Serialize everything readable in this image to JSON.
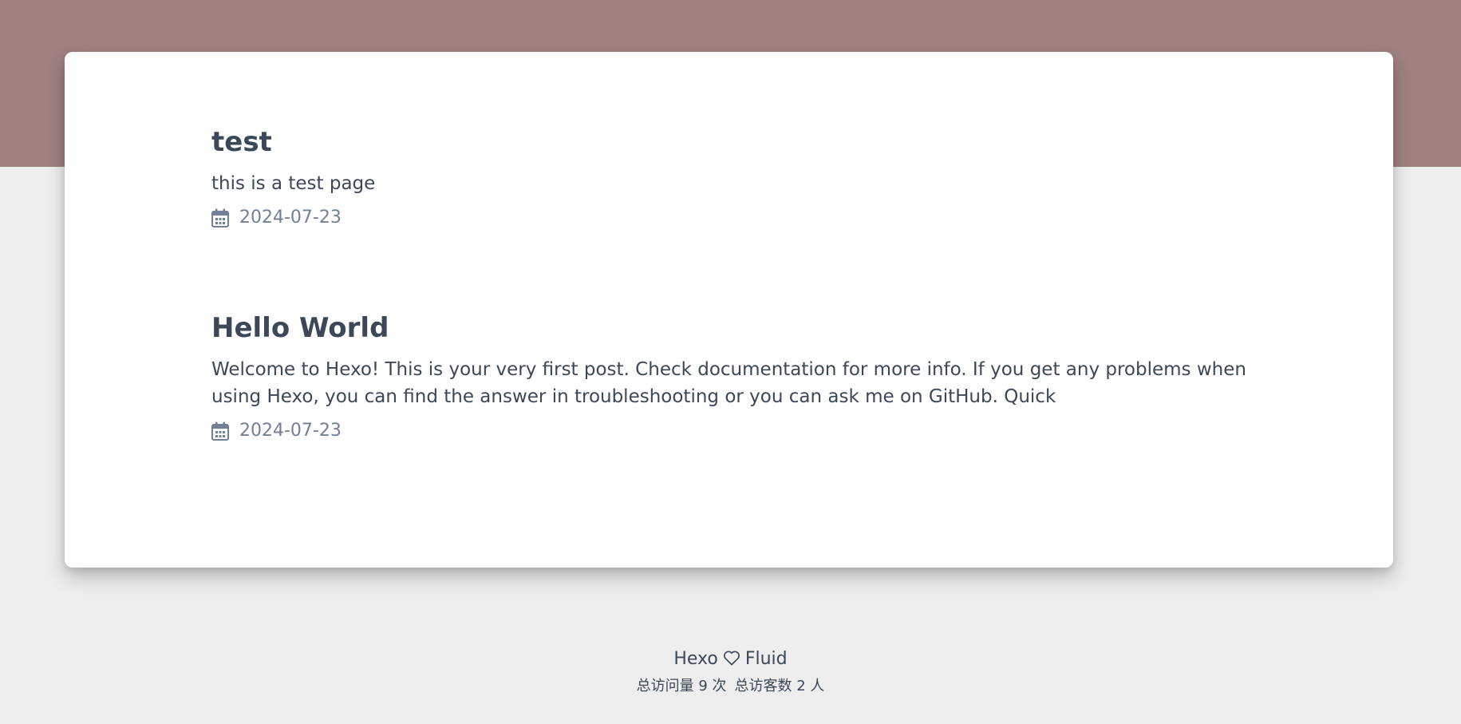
{
  "posts": [
    {
      "title": "test",
      "excerpt": "this is a test page",
      "date": "2024-07-23",
      "date_icon": "calendar-icon"
    },
    {
      "title": "Hello World",
      "excerpt": "Welcome to Hexo! This is your very first post. Check documentation for more info. If you get any problems when using Hexo, you can find the answer in troubleshooting or you can ask me on GitHub. Quick",
      "date": "2024-07-23",
      "date_icon": "calendar-icon"
    }
  ],
  "footer": {
    "hexo_label": "Hexo",
    "heart_icon": "heart-icon",
    "fluid_label": "Fluid",
    "stats": {
      "total_views": "总访问量 9 次",
      "total_visitors": "总访客数 2 人"
    }
  },
  "colors": {
    "banner": "#a08080",
    "background": "#eeeeee",
    "card": "#ffffff",
    "text": "#3c4858",
    "meta": "#718096"
  }
}
